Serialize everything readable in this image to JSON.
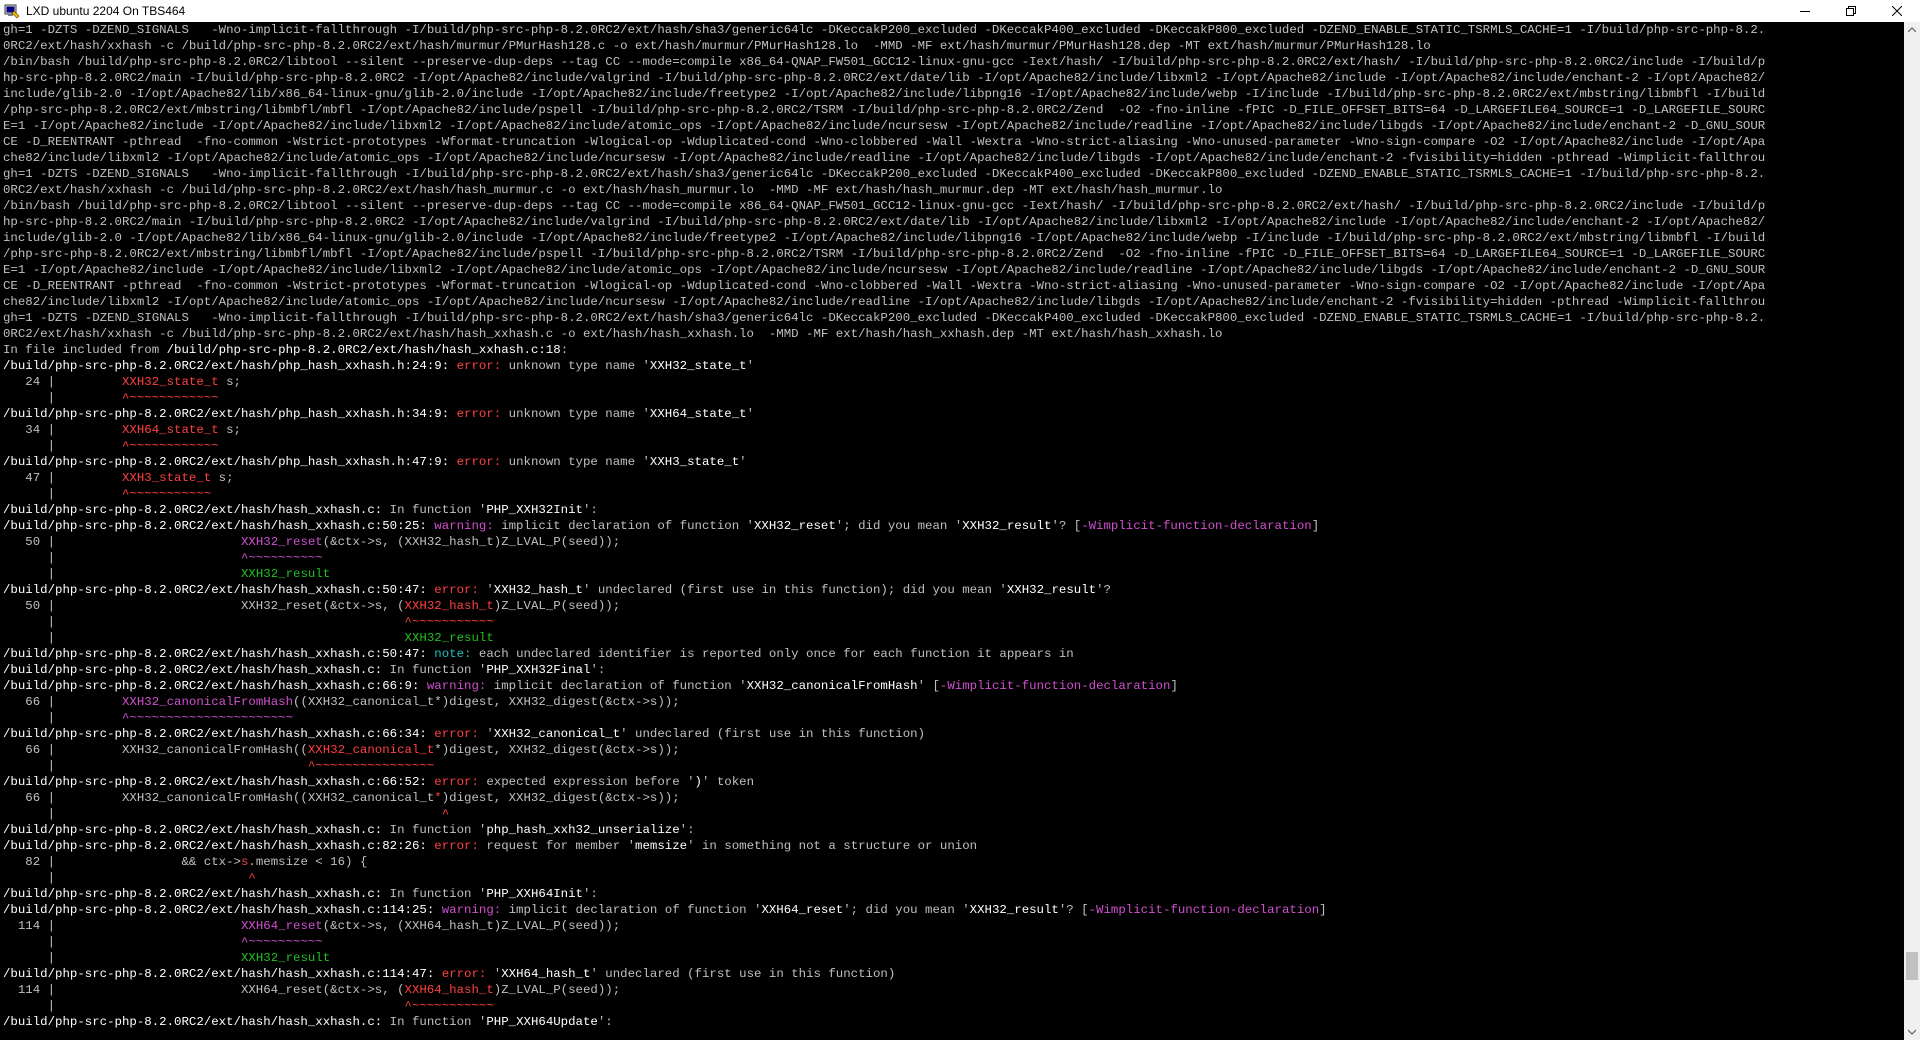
{
  "window": {
    "title": "LXD ubuntu 2204 On TBS464",
    "icons": {
      "app": "putty-terminal-icon",
      "minimize": "minimize-icon",
      "maximize": "maximize-icon",
      "close": "close-icon"
    }
  },
  "terminal": {
    "lines": [
      [
        [
          "gh=1 -DZTS -DZEND_SIGNALS   -Wno-implicit-fallthrough -I/build/php-src-php-8.2.0RC2/ext/hash/sha3/generic64lc -DKeccakP200_excluded -DKeccakP400_excluded -DKeccakP800_excluded -DZEND_ENABLE_STATIC_TSRMLS_CACHE=1 -I/build/php-src-php-8.2.",
          ""
        ]
      ],
      [
        [
          "0RC2/ext/hash/xxhash -c /build/php-src-php-8.2.0RC2/ext/hash/murmur/PMurHash128.c -o ext/hash/murmur/PMurHash128.lo  -MMD -MF ext/hash/murmur/PMurHash128.dep -MT ext/hash/murmur/PMurHash128.lo",
          ""
        ]
      ],
      [
        [
          "/bin/bash /build/php-src-php-8.2.0RC2/libtool --silent --preserve-dup-deps --tag CC --mode=compile x86_64-QNAP_FW501_GCC12-linux-gnu-gcc -Iext/hash/ -I/build/php-src-php-8.2.0RC2/ext/hash/ -I/build/php-src-php-8.2.0RC2/include -I/build/p",
          ""
        ]
      ],
      [
        [
          "hp-src-php-8.2.0RC2/main -I/build/php-src-php-8.2.0RC2 -I/opt/Apache82/include/valgrind -I/build/php-src-php-8.2.0RC2/ext/date/lib -I/opt/Apache82/include/libxml2 -I/opt/Apache82/include -I/opt/Apache82/include/enchant-2 -I/opt/Apache82/",
          ""
        ]
      ],
      [
        [
          "include/glib-2.0 -I/opt/Apache82/lib/x86_64-linux-gnu/glib-2.0/include -I/opt/Apache82/include/freetype2 -I/opt/Apache82/include/libpng16 -I/opt/Apache82/include/webp -I/include -I/build/php-src-php-8.2.0RC2/ext/mbstring/libmbfl -I/build",
          ""
        ]
      ],
      [
        [
          "/php-src-php-8.2.0RC2/ext/mbstring/libmbfl/mbfl -I/opt/Apache82/include/pspell -I/build/php-src-php-8.2.0RC2/TSRM -I/build/php-src-php-8.2.0RC2/Zend  -O2 -fno-inline -fPIC -D_FILE_OFFSET_BITS=64 -D_LARGEFILE64_SOURCE=1 -D_LARGEFILE_SOURC",
          ""
        ]
      ],
      [
        [
          "E=1 -I/opt/Apache82/include -I/opt/Apache82/include/libxml2 -I/opt/Apache82/include/atomic_ops -I/opt/Apache82/include/ncursesw -I/opt/Apache82/include/readline -I/opt/Apache82/include/libgds -I/opt/Apache82/include/enchant-2 -D_GNU_SOUR",
          ""
        ]
      ],
      [
        [
          "CE -D_REENTRANT -pthread  -fno-common -Wstrict-prototypes -Wformat-truncation -Wlogical-op -Wduplicated-cond -Wno-clobbered -Wall -Wextra -Wno-strict-aliasing -Wno-unused-parameter -Wno-sign-compare -O2 -I/opt/Apache82/include -I/opt/Apa",
          ""
        ]
      ],
      [
        [
          "che82/include/libxml2 -I/opt/Apache82/include/atomic_ops -I/opt/Apache82/include/ncursesw -I/opt/Apache82/include/readline -I/opt/Apache82/include/libgds -I/opt/Apache82/include/enchant-2 -fvisibility=hidden -pthread -Wimplicit-fallthrou",
          ""
        ]
      ],
      [
        [
          "gh=1 -DZTS -DZEND_SIGNALS   -Wno-implicit-fallthrough -I/build/php-src-php-8.2.0RC2/ext/hash/sha3/generic64lc -DKeccakP200_excluded -DKeccakP400_excluded -DKeccakP800_excluded -DZEND_ENABLE_STATIC_TSRMLS_CACHE=1 -I/build/php-src-php-8.2.",
          ""
        ]
      ],
      [
        [
          "0RC2/ext/hash/xxhash -c /build/php-src-php-8.2.0RC2/ext/hash/hash_murmur.c -o ext/hash/hash_murmur.lo  -MMD -MF ext/hash/hash_murmur.dep -MT ext/hash/hash_murmur.lo",
          ""
        ]
      ],
      [
        [
          "/bin/bash /build/php-src-php-8.2.0RC2/libtool --silent --preserve-dup-deps --tag CC --mode=compile x86_64-QNAP_FW501_GCC12-linux-gnu-gcc -Iext/hash/ -I/build/php-src-php-8.2.0RC2/ext/hash/ -I/build/php-src-php-8.2.0RC2/include -I/build/p",
          ""
        ]
      ],
      [
        [
          "hp-src-php-8.2.0RC2/main -I/build/php-src-php-8.2.0RC2 -I/opt/Apache82/include/valgrind -I/build/php-src-php-8.2.0RC2/ext/date/lib -I/opt/Apache82/include/libxml2 -I/opt/Apache82/include -I/opt/Apache82/include/enchant-2 -I/opt/Apache82/",
          ""
        ]
      ],
      [
        [
          "include/glib-2.0 -I/opt/Apache82/lib/x86_64-linux-gnu/glib-2.0/include -I/opt/Apache82/include/freetype2 -I/opt/Apache82/include/libpng16 -I/opt/Apache82/include/webp -I/include -I/build/php-src-php-8.2.0RC2/ext/mbstring/libmbfl -I/build",
          ""
        ]
      ],
      [
        [
          "/php-src-php-8.2.0RC2/ext/mbstring/libmbfl/mbfl -I/opt/Apache82/include/pspell -I/build/php-src-php-8.2.0RC2/TSRM -I/build/php-src-php-8.2.0RC2/Zend  -O2 -fno-inline -fPIC -D_FILE_OFFSET_BITS=64 -D_LARGEFILE64_SOURCE=1 -D_LARGEFILE_SOURC",
          ""
        ]
      ],
      [
        [
          "E=1 -I/opt/Apache82/include -I/opt/Apache82/include/libxml2 -I/opt/Apache82/include/atomic_ops -I/opt/Apache82/include/ncursesw -I/opt/Apache82/include/readline -I/opt/Apache82/include/libgds -I/opt/Apache82/include/enchant-2 -D_GNU_SOUR",
          ""
        ]
      ],
      [
        [
          "CE -D_REENTRANT -pthread  -fno-common -Wstrict-prototypes -Wformat-truncation -Wlogical-op -Wduplicated-cond -Wno-clobbered -Wall -Wextra -Wno-strict-aliasing -Wno-unused-parameter -Wno-sign-compare -O2 -I/opt/Apache82/include -I/opt/Apa",
          ""
        ]
      ],
      [
        [
          "che82/include/libxml2 -I/opt/Apache82/include/atomic_ops -I/opt/Apache82/include/ncursesw -I/opt/Apache82/include/readline -I/opt/Apache82/include/libgds -I/opt/Apache82/include/enchant-2 -fvisibility=hidden -pthread -Wimplicit-fallthrou",
          ""
        ]
      ],
      [
        [
          "gh=1 -DZTS -DZEND_SIGNALS   -Wno-implicit-fallthrough -I/build/php-src-php-8.2.0RC2/ext/hash/sha3/generic64lc -DKeccakP200_excluded -DKeccakP400_excluded -DKeccakP800_excluded -DZEND_ENABLE_STATIC_TSRMLS_CACHE=1 -I/build/php-src-php-8.2.",
          ""
        ]
      ],
      [
        [
          "0RC2/ext/hash/xxhash -c /build/php-src-php-8.2.0RC2/ext/hash/hash_xxhash.c -o ext/hash/hash_xxhash.lo  -MMD -MF ext/hash/hash_xxhash.dep -MT ext/hash/hash_xxhash.lo",
          ""
        ]
      ],
      [
        [
          "In file included from ",
          ""
        ],
        [
          "/build/php-src-php-8.2.0RC2/ext/hash/hash_xxhash.c:18",
          "b"
        ],
        [
          ":",
          ""
        ]
      ],
      [
        [
          "/build/php-src-php-8.2.0RC2/ext/hash/php_hash_xxhash.h:24:9: ",
          "b"
        ],
        [
          "error: ",
          "r"
        ],
        [
          "unknown type name '",
          ""
        ],
        [
          "XXH32_state_t",
          "b"
        ],
        [
          "'",
          ""
        ]
      ],
      [
        [
          "   24 |         ",
          ""
        ],
        [
          "XXH32_state_t",
          "r"
        ],
        [
          " s;",
          ""
        ]
      ],
      [
        [
          "      |         ",
          ""
        ],
        [
          "^~~~~~~~~~~~~",
          "r"
        ]
      ],
      [
        [
          "/build/php-src-php-8.2.0RC2/ext/hash/php_hash_xxhash.h:34:9: ",
          "b"
        ],
        [
          "error: ",
          "r"
        ],
        [
          "unknown type name '",
          ""
        ],
        [
          "XXH64_state_t",
          "b"
        ],
        [
          "'",
          ""
        ]
      ],
      [
        [
          "   34 |         ",
          ""
        ],
        [
          "XXH64_state_t",
          "r"
        ],
        [
          " s;",
          ""
        ]
      ],
      [
        [
          "      |         ",
          ""
        ],
        [
          "^~~~~~~~~~~~~",
          "r"
        ]
      ],
      [
        [
          "/build/php-src-php-8.2.0RC2/ext/hash/php_hash_xxhash.h:47:9: ",
          "b"
        ],
        [
          "error: ",
          "r"
        ],
        [
          "unknown type name '",
          ""
        ],
        [
          "XXH3_state_t",
          "b"
        ],
        [
          "'",
          ""
        ]
      ],
      [
        [
          "   47 |         ",
          ""
        ],
        [
          "XXH3_state_t",
          "r"
        ],
        [
          " s;",
          ""
        ]
      ],
      [
        [
          "      |         ",
          ""
        ],
        [
          "^~~~~~~~~~~~",
          "r"
        ]
      ],
      [
        [
          "/build/php-src-php-8.2.0RC2/ext/hash/hash_xxhash.c:",
          "b"
        ],
        [
          " In function '",
          ""
        ],
        [
          "PHP_XXH32Init",
          "b"
        ],
        [
          "':",
          ""
        ]
      ],
      [
        [
          "/build/php-src-php-8.2.0RC2/ext/hash/hash_xxhash.c:50:25: ",
          "b"
        ],
        [
          "warning: ",
          "m"
        ],
        [
          "implicit declaration of function '",
          ""
        ],
        [
          "XXH32_reset",
          "b"
        ],
        [
          "'; did you mean '",
          ""
        ],
        [
          "XXH32_result",
          "b"
        ],
        [
          "'? [",
          ""
        ],
        [
          "-Wimplicit-function-declaration",
          "m"
        ],
        [
          "]",
          ""
        ]
      ],
      [
        [
          "   50 |                         ",
          ""
        ],
        [
          "XXH32_reset",
          "m"
        ],
        [
          "(&ctx->s, (XXH32_hash_t)Z_LVAL_P(seed));",
          ""
        ]
      ],
      [
        [
          "      |                         ",
          ""
        ],
        [
          "^~~~~~~~~~~",
          "m"
        ]
      ],
      [
        [
          "      |                         ",
          ""
        ],
        [
          "XXH32_result",
          "g"
        ]
      ],
      [
        [
          "/build/php-src-php-8.2.0RC2/ext/hash/hash_xxhash.c:50:47: ",
          "b"
        ],
        [
          "error: ",
          "r"
        ],
        [
          "'",
          ""
        ],
        [
          "XXH32_hash_t",
          "b"
        ],
        [
          "' undeclared (first use in this function); did you mean '",
          ""
        ],
        [
          "XXH32_result",
          "b"
        ],
        [
          "'?",
          ""
        ]
      ],
      [
        [
          "   50 |                         XXH32_reset(&ctx->s, (",
          ""
        ],
        [
          "XXH32_hash_t",
          "r"
        ],
        [
          ")Z_LVAL_P(seed));",
          ""
        ]
      ],
      [
        [
          "      |                                               ",
          ""
        ],
        [
          "^~~~~~~~~~~~",
          "r"
        ]
      ],
      [
        [
          "      |                                               ",
          ""
        ],
        [
          "XXH32_result",
          "g"
        ]
      ],
      [
        [
          "/build/php-src-php-8.2.0RC2/ext/hash/hash_xxhash.c:50:47: ",
          "b"
        ],
        [
          "note: ",
          "c"
        ],
        [
          "each undeclared identifier is reported only once for each function it appears in",
          ""
        ]
      ],
      [
        [
          "/build/php-src-php-8.2.0RC2/ext/hash/hash_xxhash.c:",
          "b"
        ],
        [
          " In function '",
          ""
        ],
        [
          "PHP_XXH32Final",
          "b"
        ],
        [
          "':",
          ""
        ]
      ],
      [
        [
          "/build/php-src-php-8.2.0RC2/ext/hash/hash_xxhash.c:66:9: ",
          "b"
        ],
        [
          "warning: ",
          "m"
        ],
        [
          "implicit declaration of function '",
          ""
        ],
        [
          "XXH32_canonicalFromHash",
          "b"
        ],
        [
          "' [",
          ""
        ],
        [
          "-Wimplicit-function-declaration",
          "m"
        ],
        [
          "]",
          ""
        ]
      ],
      [
        [
          "   66 |         ",
          ""
        ],
        [
          "XXH32_canonicalFromHash",
          "m"
        ],
        [
          "((XXH32_canonical_t*)digest, XXH32_digest(&ctx->s));",
          ""
        ]
      ],
      [
        [
          "      |         ",
          ""
        ],
        [
          "^~~~~~~~~~~~~~~~~~~~~~~",
          "m"
        ]
      ],
      [
        [
          "/build/php-src-php-8.2.0RC2/ext/hash/hash_xxhash.c:66:34: ",
          "b"
        ],
        [
          "error: ",
          "r"
        ],
        [
          "'",
          ""
        ],
        [
          "XXH32_canonical_t",
          "b"
        ],
        [
          "' undeclared (first use in this function)",
          ""
        ]
      ],
      [
        [
          "   66 |         XXH32_canonicalFromHash((",
          ""
        ],
        [
          "XXH32_canonical_t",
          "r"
        ],
        [
          "*)digest, XXH32_digest(&ctx->s));",
          ""
        ]
      ],
      [
        [
          "      |                                  ",
          ""
        ],
        [
          "^~~~~~~~~~~~~~~~~",
          "r"
        ]
      ],
      [
        [
          "/build/php-src-php-8.2.0RC2/ext/hash/hash_xxhash.c:66:52: ",
          "b"
        ],
        [
          "error: ",
          "r"
        ],
        [
          "expected expression before '",
          ""
        ],
        [
          ")",
          "b"
        ],
        [
          "' token",
          ""
        ]
      ],
      [
        [
          "   66 |         XXH32_canonicalFromHash((XXH32_canonical_t",
          ""
        ],
        [
          "*",
          "r"
        ],
        [
          ")digest, XXH32_digest(&ctx->s));",
          ""
        ]
      ],
      [
        [
          "      |                                                    ",
          ""
        ],
        [
          "^",
          "r"
        ]
      ],
      [
        [
          "/build/php-src-php-8.2.0RC2/ext/hash/hash_xxhash.c:",
          "b"
        ],
        [
          " In function '",
          ""
        ],
        [
          "php_hash_xxh32_unserialize",
          "b"
        ],
        [
          "':",
          ""
        ]
      ],
      [
        [
          "/build/php-src-php-8.2.0RC2/ext/hash/hash_xxhash.c:82:26: ",
          "b"
        ],
        [
          "error: ",
          "r"
        ],
        [
          "request for member '",
          ""
        ],
        [
          "memsize",
          "b"
        ],
        [
          "' in something not a structure or union",
          ""
        ]
      ],
      [
        [
          "   82 |                 && ctx->",
          ""
        ],
        [
          "s",
          "r"
        ],
        [
          ".memsize < 16) {",
          ""
        ]
      ],
      [
        [
          "      |                          ",
          ""
        ],
        [
          "^",
          "r"
        ]
      ],
      [
        [
          "/build/php-src-php-8.2.0RC2/ext/hash/hash_xxhash.c:",
          "b"
        ],
        [
          " In function '",
          ""
        ],
        [
          "PHP_XXH64Init",
          "b"
        ],
        [
          "':",
          ""
        ]
      ],
      [
        [
          "/build/php-src-php-8.2.0RC2/ext/hash/hash_xxhash.c:114:25: ",
          "b"
        ],
        [
          "warning: ",
          "m"
        ],
        [
          "implicit declaration of function '",
          ""
        ],
        [
          "XXH64_reset",
          "b"
        ],
        [
          "'; did you mean '",
          ""
        ],
        [
          "XXH32_result",
          "b"
        ],
        [
          "'? [",
          ""
        ],
        [
          "-Wimplicit-function-declaration",
          "m"
        ],
        [
          "]",
          ""
        ]
      ],
      [
        [
          "  114 |                         ",
          ""
        ],
        [
          "XXH64_reset",
          "m"
        ],
        [
          "(&ctx->s, (XXH64_hash_t)Z_LVAL_P(seed));",
          ""
        ]
      ],
      [
        [
          "      |                         ",
          ""
        ],
        [
          "^~~~~~~~~~~",
          "m"
        ]
      ],
      [
        [
          "      |                         ",
          ""
        ],
        [
          "XXH32_result",
          "g"
        ]
      ],
      [
        [
          "/build/php-src-php-8.2.0RC2/ext/hash/hash_xxhash.c:114:47: ",
          "b"
        ],
        [
          "error: ",
          "r"
        ],
        [
          "'",
          ""
        ],
        [
          "XXH64_hash_t",
          "b"
        ],
        [
          "' undeclared (first use in this function)",
          ""
        ]
      ],
      [
        [
          "  114 |                         XXH64_reset(&ctx->s, (",
          ""
        ],
        [
          "XXH64_hash_t",
          "r"
        ],
        [
          ")Z_LVAL_P(seed));",
          ""
        ]
      ],
      [
        [
          "      |                                               ",
          ""
        ],
        [
          "^~~~~~~~~~~~",
          "r"
        ]
      ],
      [
        [
          "/build/php-src-php-8.2.0RC2/ext/hash/hash_xxhash.c:",
          "b"
        ],
        [
          " In function '",
          ""
        ],
        [
          "PHP_XXH64Update",
          "b"
        ],
        [
          "':",
          ""
        ]
      ]
    ]
  },
  "colors": {
    "background": "#000000",
    "default_text": "#c0c0c0",
    "bold_text": "#ffffff",
    "error": "#ff4040",
    "warning": "#d050d0",
    "fixit": "#20c020",
    "note": "#20c0c0"
  }
}
